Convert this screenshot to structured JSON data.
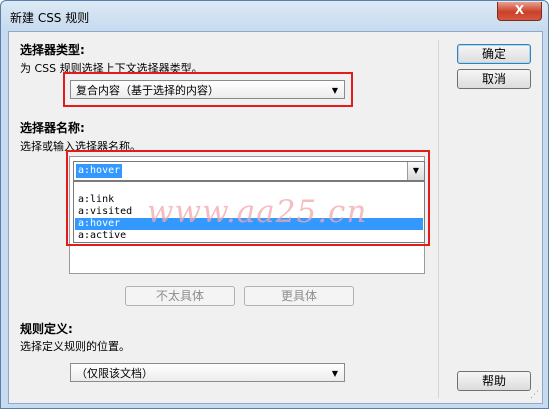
{
  "window": {
    "title": "新建 CSS 规则",
    "close_glyph": "X"
  },
  "selector_type": {
    "heading": "选择器类型:",
    "hint": "为 CSS 规则选择上下文选择器类型。",
    "value": "复合内容（基于选择的内容）"
  },
  "selector_name": {
    "heading": "选择器名称:",
    "hint": "选择或输入选择器名称。",
    "value": "a:hover",
    "options": [
      "a:link",
      "a:visited",
      "a:hover",
      "a:active"
    ],
    "selected_index": 2
  },
  "specificity": {
    "less_label": "不太具体",
    "more_label": "更具体"
  },
  "rule_definition": {
    "heading": "规则定义:",
    "hint": "选择定义规则的位置。",
    "value": "（仅限该文档）"
  },
  "buttons": {
    "ok": "确定",
    "cancel": "取消",
    "help": "帮助"
  },
  "watermark": "www.aa25.cn",
  "colors": {
    "highlight": "#3399ff",
    "annotation": "#e21b1b",
    "watermark": "#f2a7ad"
  }
}
